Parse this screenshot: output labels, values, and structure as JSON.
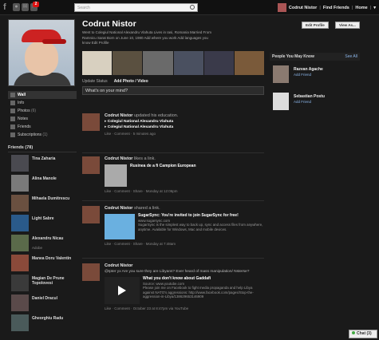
{
  "topbar": {
    "logo": "f",
    "notification_count": "2",
    "search_placeholder": "Search",
    "user_name": "Codrut Nistor",
    "find_friends": "Find Friends",
    "home": "Home"
  },
  "profile": {
    "name": "Codrut Nistor",
    "info_line1": "Went to Colegiul National Alexandru Vlahuta  Lives in Iasi, Romania  Married  From",
    "info_line2": "Ramnicu Sarat  Born on June 10, 1980  Add where you work  Add languages you",
    "info_line3": "know  Edit Profile",
    "edit_profile_button": "Edit Profile",
    "view_as_button": "View As..."
  },
  "nav": {
    "items": [
      {
        "label": "Wall"
      },
      {
        "label": "Info"
      },
      {
        "label": "Photos",
        "count": "(6)"
      },
      {
        "label": "Notes"
      },
      {
        "label": "Friends"
      },
      {
        "label": "Subscriptions",
        "count": "(1)"
      }
    ]
  },
  "friends": {
    "title": "Friends (78)",
    "list": [
      {
        "name": "Tina Zaharia",
        "sub": ""
      },
      {
        "name": "Alina Manole",
        "sub": ""
      },
      {
        "name": "Mihaela Dumitrescu",
        "sub": ""
      },
      {
        "name": "Light Sabre",
        "sub": ""
      },
      {
        "name": "Alexandru Nicau",
        "sub": "Adobe"
      },
      {
        "name": "Manea Doru Valentin",
        "sub": ""
      },
      {
        "name": "Magian De Prune Topolovesi",
        "sub": ""
      },
      {
        "name": "Daniel Dracul",
        "sub": ""
      },
      {
        "name": "Gheorghiu Radu",
        "sub": ""
      }
    ]
  },
  "composer": {
    "tab_status": "Update Status",
    "tab_photo": "Add Photo / Video",
    "placeholder": "What's on your mind?"
  },
  "stories": [
    {
      "actor": "Codrut Nistor",
      "action": "updated his education.",
      "line1": "Colegiul National Alexandru Vlahuta",
      "line2": "Colegiul National Alexandru Vlahuta",
      "meta": "Like · Comment · 5 minutes ago"
    },
    {
      "actor": "Codrut Nistor",
      "action": "likes a link.",
      "link_title": "Rusinea de a fi Campion European",
      "meta": "Like · Comment · Share · Monday at 12:06pm"
    },
    {
      "actor": "Codrut Nistor",
      "action": "shared a link.",
      "link_title": "SugarSync: You're invited to join SugarSync for free!",
      "source": "www.sugarsync.com",
      "desc": "SugarSync is the simplest way to back up, sync and access files from anywhere, anytime. Available for Windows, Mac and mobile devices.",
      "meta": "Like · Comment · Share · Monday at 7:48am"
    },
    {
      "actor": "Codrut Nistor",
      "text": "@Ipter yx Are you sure they are Libyans? Ever heard of mass manipulation/ Nsterse?",
      "link_title": "What you don't know about Gaddafi",
      "source": "Source: www.youtube.com",
      "desc": "Please join me on Facebook to fight media propaganda and help Libya against NATO's aggressions: http://www.facebook.com/pages/Stop-the-aggression-in-Libya/138629653146909",
      "meta": "Like · Comment · October 23 at 8:47pm via YouTube"
    }
  ],
  "people_you_may_know": {
    "title": "People You May Know",
    "see_all": "See All",
    "people": [
      {
        "name": "Razvan Agache",
        "action": "Add Friend"
      },
      {
        "name": "Sebastian Postu",
        "action": "Add Friend"
      }
    ]
  },
  "chat": {
    "label": "Chat (3)"
  }
}
